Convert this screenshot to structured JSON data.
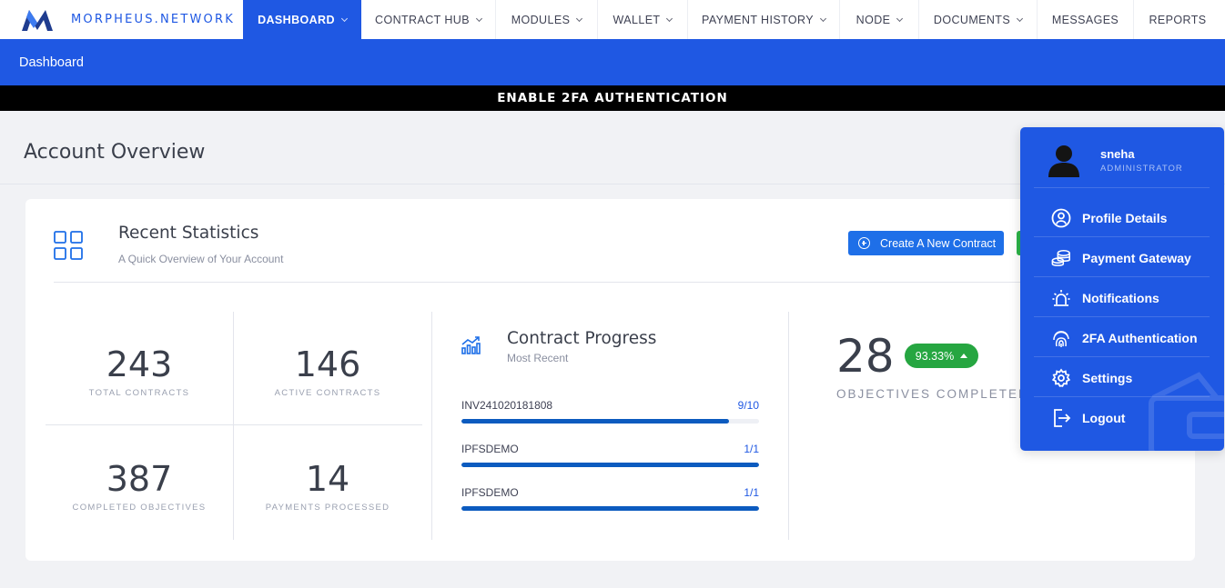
{
  "brand": {
    "name": "MORPHEUS.NETWORK"
  },
  "nav": {
    "items": [
      {
        "label": "DASHBOARD",
        "dropdown": true,
        "active": true
      },
      {
        "label": "CONTRACT HUB",
        "dropdown": true
      },
      {
        "label": "MODULES",
        "dropdown": true
      },
      {
        "label": "WALLET",
        "dropdown": true
      },
      {
        "label": "PAYMENT HISTORY",
        "dropdown": true
      },
      {
        "label": "NODE",
        "dropdown": true
      },
      {
        "label": "DOCUMENTS",
        "dropdown": true
      },
      {
        "label": "MESSAGES",
        "dropdown": false
      },
      {
        "label": "REPORTS",
        "dropdown": false
      }
    ]
  },
  "breadcrumb": "Dashboard",
  "alert": "ENABLE 2FA AUTHENTICATION",
  "page_title": "Account Overview",
  "card": {
    "title": "Recent Statistics",
    "subtitle": "A Quick Overview of Your Account",
    "create_button": "Create A New Contract"
  },
  "stats": [
    {
      "value": "243",
      "label": "TOTAL CONTRACTS"
    },
    {
      "value": "146",
      "label": "ACTIVE CONTRACTS"
    },
    {
      "value": "387",
      "label": "COMPLETED OBJECTIVES"
    },
    {
      "value": "14",
      "label": "PAYMENTS PROCESSED"
    }
  ],
  "progress": {
    "title": "Contract Progress",
    "subtitle": "Most Recent",
    "items": [
      {
        "name": "INV241020181808",
        "frac": "9/10",
        "value": 0.9
      },
      {
        "name": "IPFSDEMO",
        "frac": "1/1",
        "value": 1.0
      },
      {
        "name": "IPFSDEMO",
        "frac": "1/1",
        "value": 1.0
      }
    ]
  },
  "objectives": {
    "value": "28",
    "badge": "93.33%",
    "label": "OBJECTIVES COMPLETED TH"
  },
  "user_menu": {
    "name": "sneha",
    "role": "ADMINISTRATOR",
    "items": [
      {
        "label": "Profile Details",
        "icon": "profile-icon"
      },
      {
        "label": "Payment Gateway",
        "icon": "coins-icon"
      },
      {
        "label": "Notifications",
        "icon": "alarm-icon"
      },
      {
        "label": "2FA Authentication",
        "icon": "fingerprint-icon"
      },
      {
        "label": "Settings",
        "icon": "gear-icon"
      },
      {
        "label": "Logout",
        "icon": "logout-icon"
      }
    ]
  },
  "colors": {
    "primary": "#1f58e3",
    "success": "#26a641",
    "progress": "#0c5bbf"
  }
}
